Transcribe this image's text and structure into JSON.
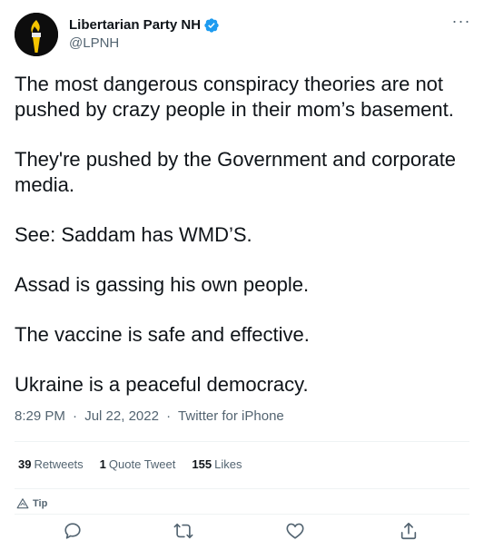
{
  "author": {
    "display_name": "Libertarian Party NH",
    "handle": "@LPNH",
    "avatar_icon": "torch-icon",
    "verified_icon": "verified-badge-icon",
    "verified_color": "#1d9bf0"
  },
  "tweet": {
    "paragraphs": [
      "The most dangerous conspiracy theories are not pushed by crazy people in their mom’s basement.",
      "They're pushed by the Government and corporate media.",
      "See: Saddam has WMD’S.",
      "Assad is gassing his own people.",
      "The vaccine is safe and effective.",
      "Ukraine is a peaceful democracy."
    ],
    "time": "8:29 PM",
    "date": "Jul 22, 2022",
    "source": "Twitter for iPhone",
    "separator": "·"
  },
  "stats": {
    "retweets_count": "39",
    "retweets_label": "Retweets",
    "quotes_count": "1",
    "quotes_label": "Quote Tweet",
    "likes_count": "155",
    "likes_label": "Likes"
  },
  "tip": {
    "label": "Tip",
    "icon": "tip-icon"
  },
  "actions": {
    "reply_icon": "reply-icon",
    "retweet_icon": "retweet-icon",
    "like_icon": "like-icon",
    "share_icon": "share-icon"
  },
  "more_menu": {
    "label": "···"
  },
  "colors": {
    "text_primary": "#0f1419",
    "text_secondary": "#536471",
    "divider": "#eff3f4",
    "accent": "#1d9bf0",
    "avatar_flame": "#f5c400"
  }
}
